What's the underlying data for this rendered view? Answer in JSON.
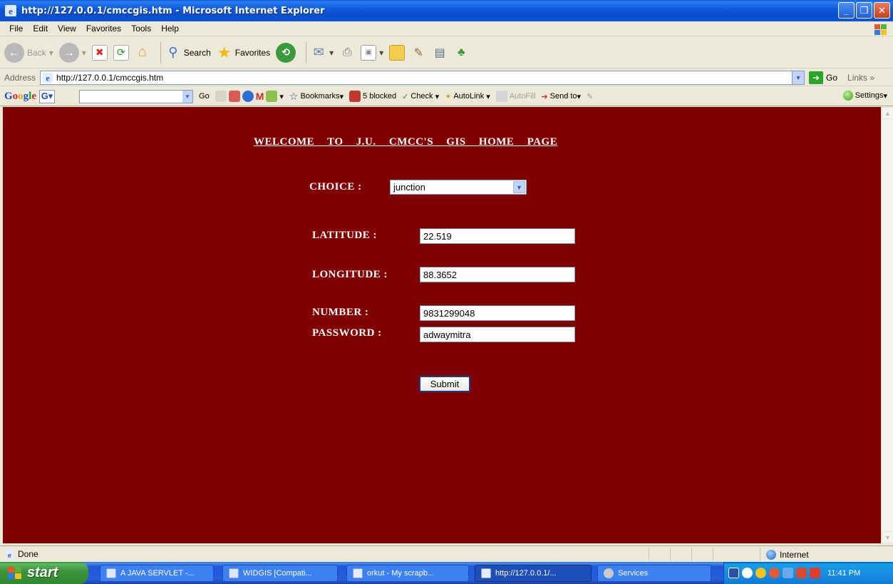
{
  "window": {
    "title": "http://127.0.0.1/cmccgis.htm - Microsoft Internet Explorer"
  },
  "menu": [
    "File",
    "Edit",
    "View",
    "Favorites",
    "Tools",
    "Help"
  ],
  "toolbar": {
    "back": "Back",
    "search": "Search",
    "favorites": "Favorites"
  },
  "address": {
    "label": "Address",
    "url": "http://127.0.0.1/cmccgis.htm",
    "go": "Go",
    "links": "Links"
  },
  "google_bar": {
    "go": "Go",
    "bookmarks": "Bookmarks",
    "blocked": "5 blocked",
    "check": "Check",
    "autolink": "AutoLink",
    "autofill": "AutoFill",
    "send_to": "Send to",
    "settings": "Settings"
  },
  "page": {
    "background": "#800000",
    "heading": "WELCOME TO J.U. CMCC'S GIS HOME PAGE",
    "choice_label": "CHOICE :",
    "choice_value": "junction",
    "latitude_label": "LATITUDE :",
    "latitude_value": "22.519",
    "longitude_label": "LONGITUDE :",
    "longitude_value": "88.3652",
    "number_label": "NUMBER :",
    "number_value": "9831299048",
    "password_label": "PASSWORD :",
    "password_value": "adwaymitra",
    "submit": "Submit"
  },
  "status": {
    "text": "Done",
    "zone": "Internet"
  },
  "taskbar": {
    "start": "start",
    "tasks": [
      "A JAVA SERVLET -...",
      "WIDGIS [Compati...",
      "orkut - My scrapb...",
      "http://127.0.0.1/...",
      "Services"
    ],
    "clock": "11:41 PM"
  }
}
